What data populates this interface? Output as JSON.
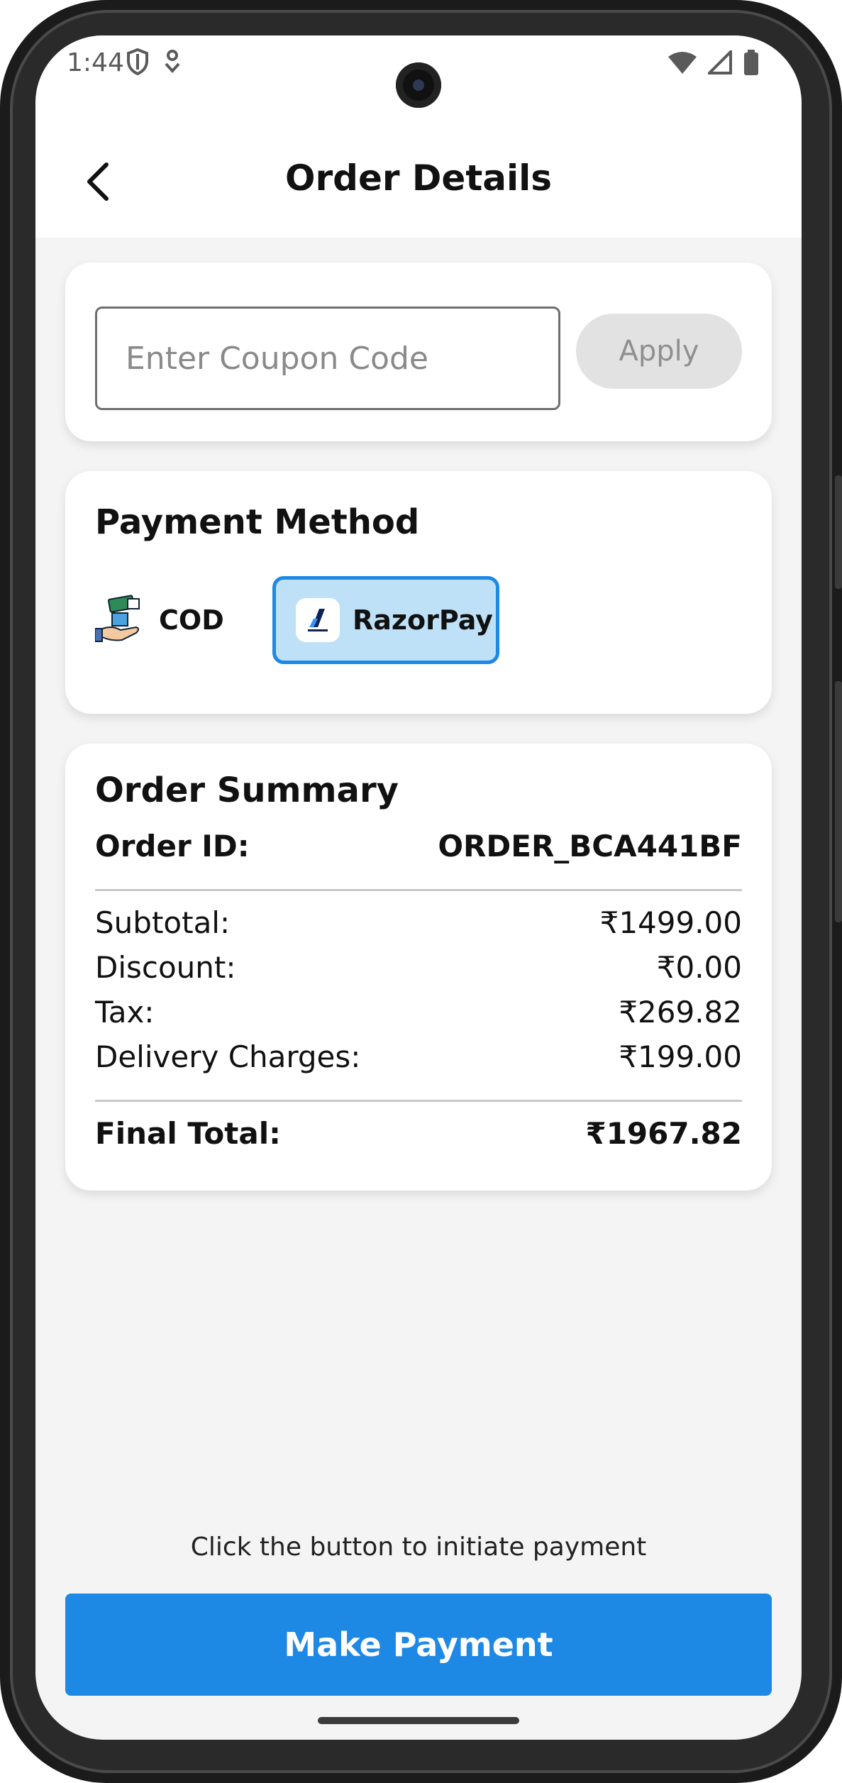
{
  "status_bar": {
    "time": "1:44",
    "icons_left": [
      "shield-icon",
      "location-icon"
    ],
    "icons_right": [
      "wifi-icon",
      "cellular-signal-icon",
      "battery-icon"
    ]
  },
  "app_bar": {
    "title": "Order Details",
    "back_icon": "back-arrow-icon"
  },
  "coupon": {
    "placeholder": "Enter Coupon Code",
    "value": "",
    "apply_label": "Apply"
  },
  "payment_method": {
    "title": "Payment Method",
    "options": [
      {
        "label": "COD",
        "icon": "cash-on-delivery-icon",
        "selected": false
      },
      {
        "label": "RazorPay",
        "icon": "razorpay-logo-icon",
        "selected": true
      }
    ]
  },
  "order_summary": {
    "title": "Order Summary",
    "order_id_label": "Order ID:",
    "order_id": "ORDER_BCA441BF",
    "lines": [
      {
        "label": "Subtotal:",
        "value": "₹1499.00"
      },
      {
        "label": "Discount:",
        "value": "₹0.00"
      },
      {
        "label": "Tax:",
        "value": "₹269.82"
      },
      {
        "label": "Delivery Charges:",
        "value": "₹199.00"
      }
    ],
    "final_label": "Final Total:",
    "final_value": "₹1967.82"
  },
  "footer": {
    "hint": "Click the button to initiate payment",
    "pay_button": "Make Payment"
  },
  "colors": {
    "primary": "#1e88e5",
    "selected_bg": "#bfe1f7",
    "background": "#f4f4f4",
    "apply_disabled": "#e2e2e2"
  }
}
